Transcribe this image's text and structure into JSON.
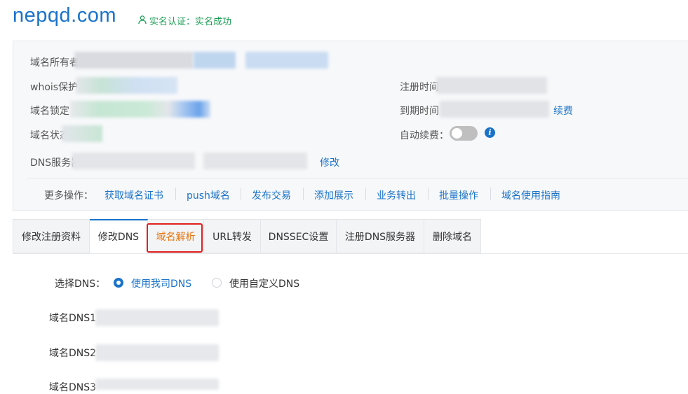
{
  "header": {
    "domain": "nepqd.com",
    "verify_text": "实名认证：实名成功"
  },
  "info": {
    "owner_label": "域名所有者",
    "whois_label": "whois保护",
    "lock_label": "域名锁定",
    "status_label": "域名状态",
    "dns_server_label": "DNS服务器",
    "dns_modify_link": "修改",
    "reg_time_label": "注册时间",
    "expire_time_label": "到期时间",
    "renew_link": "续费",
    "auto_renew_label": "自动续费：",
    "auto_renew_enabled": false
  },
  "more_ops": {
    "label": "更多操作：",
    "items": [
      "获取域名证书",
      "push域名",
      "发布交易",
      "添加展示",
      "业务转出",
      "批量操作",
      "域名使用指南"
    ]
  },
  "tabs": [
    "修改注册资料",
    "修改DNS",
    "域名解析",
    "URL转发",
    "DNSSEC设置",
    "注册DNS服务器",
    "删除域名"
  ],
  "active_tab": "修改DNS",
  "highlighted_tab": "域名解析",
  "dns_form": {
    "choose_label": "选择DNS：",
    "option_ours": "使用我司DNS",
    "option_custom": "使用自定义DNS",
    "selected": "使用我司DNS",
    "dns1_label": "域名DNS1",
    "dns2_label": "域名DNS2",
    "dns3_label": "域名DNS3"
  },
  "colors": {
    "link": "#1a73c9",
    "verified": "#1a9e55",
    "highlight_tab_text": "#e8730c",
    "highlight_box": "#e02020"
  }
}
